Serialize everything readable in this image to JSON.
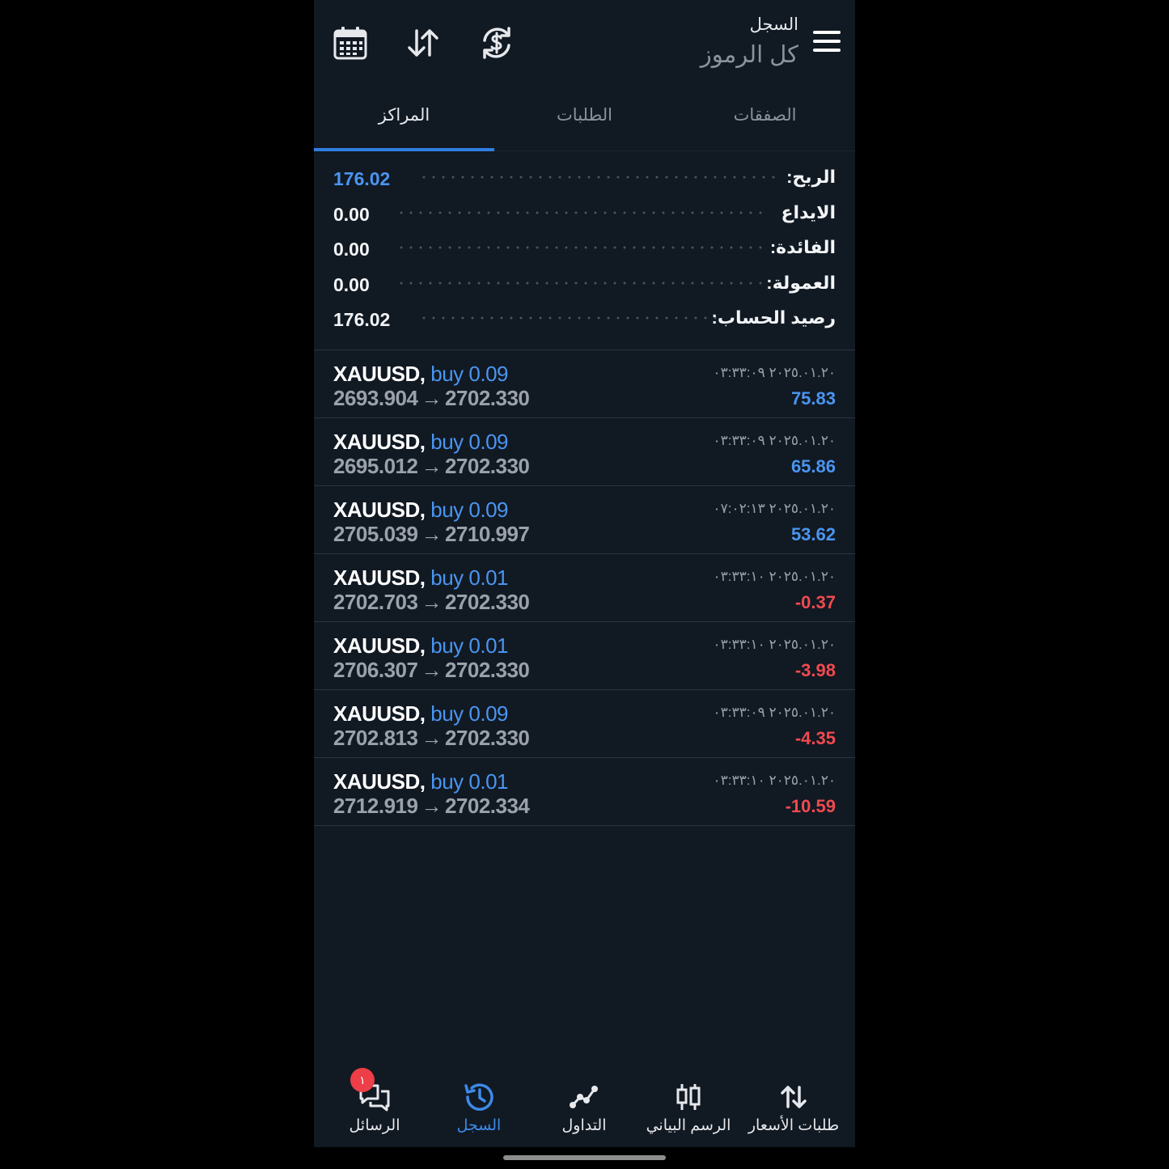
{
  "header": {
    "subtitle": "السجل",
    "title": "كل الرموز",
    "icons": [
      "calendar-icon",
      "sort-arrows-icon",
      "currency-refresh-icon",
      "menu-icon"
    ]
  },
  "tabs": [
    {
      "label": "المراكز",
      "active": true
    },
    {
      "label": "الطلبات",
      "active": false
    },
    {
      "label": "الصفقات",
      "active": false
    }
  ],
  "summary": [
    {
      "label": "الربح:",
      "value": "176.02",
      "highlight": true
    },
    {
      "label": "الايداع",
      "value": "0.00",
      "highlight": false
    },
    {
      "label": "الفائدة:",
      "value": "0.00",
      "highlight": false
    },
    {
      "label": "العمولة:",
      "value": "0.00",
      "highlight": false
    },
    {
      "label": "رصيد الحساب:",
      "value": "176.02",
      "highlight": false
    }
  ],
  "deals": [
    {
      "symbol": "XAUUSD,",
      "side": "buy 0.09",
      "open": "2693.904",
      "close": "2702.330",
      "time": "٢٠٢٥.٠١.٢٠ ٠٣:٣٣:٠٩",
      "profit": "75.83",
      "positive": true
    },
    {
      "symbol": "XAUUSD,",
      "side": "buy 0.09",
      "open": "2695.012",
      "close": "2702.330",
      "time": "٢٠٢٥.٠١.٢٠ ٠٣:٣٣:٠٩",
      "profit": "65.86",
      "positive": true
    },
    {
      "symbol": "XAUUSD,",
      "side": "buy 0.09",
      "open": "2705.039",
      "close": "2710.997",
      "time": "٢٠٢٥.٠١.٢٠ ٠٧:٠٢:١٣",
      "profit": "53.62",
      "positive": true
    },
    {
      "symbol": "XAUUSD,",
      "side": "buy 0.01",
      "open": "2702.703",
      "close": "2702.330",
      "time": "٢٠٢٥.٠١.٢٠ ٠٣:٣٣:١٠",
      "profit": "-0.37",
      "positive": false
    },
    {
      "symbol": "XAUUSD,",
      "side": "buy 0.01",
      "open": "2706.307",
      "close": "2702.330",
      "time": "٢٠٢٥.٠١.٢٠ ٠٣:٣٣:١٠",
      "profit": "-3.98",
      "positive": false
    },
    {
      "symbol": "XAUUSD,",
      "side": "buy 0.09",
      "open": "2702.813",
      "close": "2702.330",
      "time": "٢٠٢٥.٠١.٢٠ ٠٣:٣٣:٠٩",
      "profit": "-4.35",
      "positive": false
    },
    {
      "symbol": "XAUUSD,",
      "side": "buy 0.01",
      "open": "2712.919",
      "close": "2702.334",
      "time": "٢٠٢٥.٠١.٢٠ ٠٣:٣٣:١٠",
      "profit": "-10.59",
      "positive": false
    }
  ],
  "arrow": "→",
  "bottom_nav": [
    {
      "label": "الرسائل",
      "icon": "chat-icon",
      "badge": "١",
      "active": false
    },
    {
      "label": "السجل",
      "icon": "history-icon",
      "active": true
    },
    {
      "label": "التداول",
      "icon": "trade-icon",
      "active": false
    },
    {
      "label": "الرسم البياني",
      "icon": "candlestick-icon",
      "active": false
    },
    {
      "label": "طلبات الأسعار",
      "icon": "quotes-icon",
      "active": false
    }
  ],
  "colors": {
    "background": "#111923",
    "accent": "#2f7fe0",
    "positive": "#4a95f0",
    "negative": "#ef4a4f"
  }
}
